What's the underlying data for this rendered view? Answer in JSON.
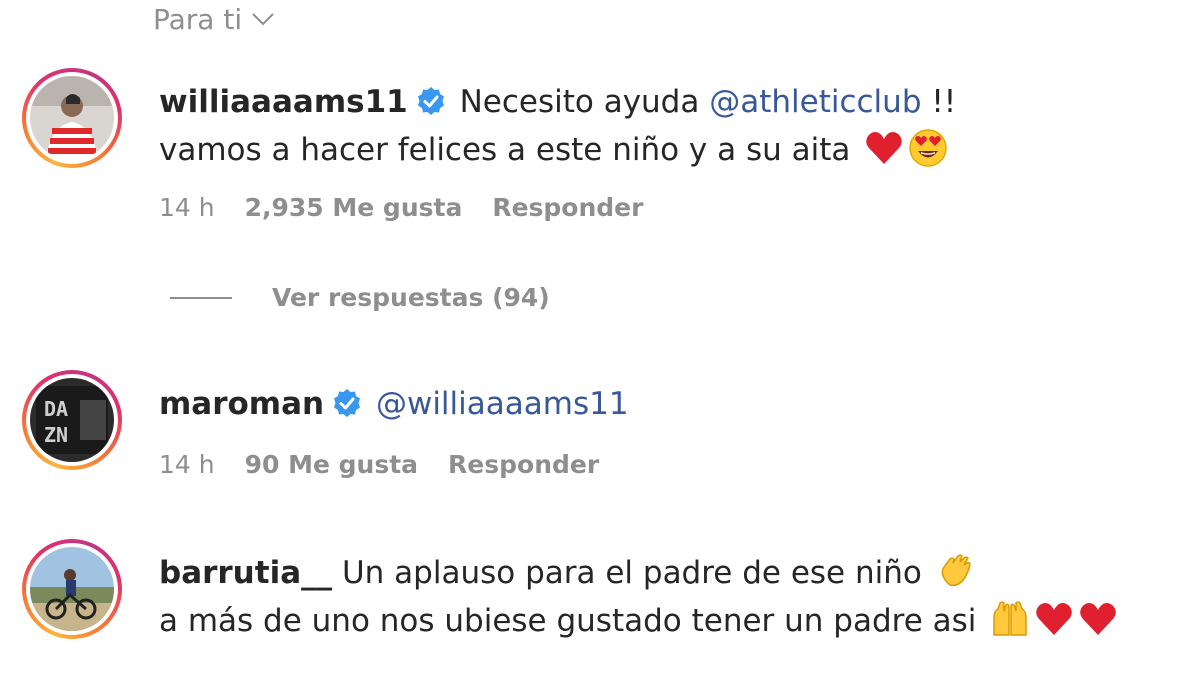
{
  "filter": {
    "label": "Para ti"
  },
  "comments": [
    {
      "username": "williaaaams11",
      "verified": true,
      "line1_text": "Necesito ayuda",
      "mention": "@athleticclub",
      "line1_tail": "!!",
      "line2_text": "vamos a hacer felices a este niño y a su aita",
      "emojis": [
        "red-heart",
        "heart-eyes-face"
      ],
      "time": "14 h",
      "likes": "2,935 Me gusta",
      "reply": "Responder",
      "view_replies": "Ver respuestas (94)"
    },
    {
      "username": "maroman",
      "verified": true,
      "mention": "@williaaaams11",
      "time": "14 h",
      "likes": "90 Me gusta",
      "reply": "Responder"
    },
    {
      "username": "barrutia__",
      "verified": false,
      "line1_text": "Un aplauso para el padre de ese niño",
      "line2_text": "a más de uno nos ubiese gustado tener un padre asi",
      "emojis_line1": [
        "clapping-hands"
      ],
      "emojis_line2": [
        "raising-hands",
        "red-heart",
        "red-heart"
      ]
    }
  ],
  "colors": {
    "mention": "#385898",
    "muted": "#8e8e8e",
    "text": "#262626",
    "verified": "#3897f0",
    "heart": "#e0202e"
  }
}
